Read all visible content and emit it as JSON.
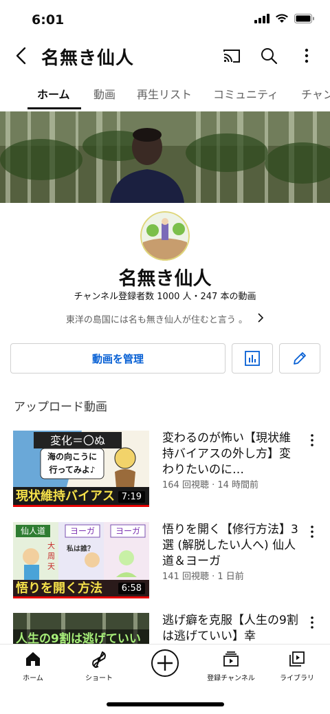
{
  "status_bar": {
    "time": "6:01"
  },
  "app_bar": {
    "title": "名無き仙人",
    "back_icon": "back-arrow-icon",
    "actions": [
      "cast-icon",
      "search-icon",
      "more-vert-icon"
    ]
  },
  "tabs": [
    {
      "label": "ホーム",
      "active": true
    },
    {
      "label": "動画"
    },
    {
      "label": "再生リスト"
    },
    {
      "label": "コミュニティ"
    },
    {
      "label": "チャン"
    }
  ],
  "channel": {
    "name": "名無き仙人",
    "meta": "チャンネル登録者数 1000 人・247 本の動画",
    "description": "東洋の島国には名も無き仙人が住むと言う 。",
    "manage_button": "動画を管理"
  },
  "section": {
    "title": "アップロード動画"
  },
  "videos": [
    {
      "title": "変わるのが怖い【現状維持バイアスの外し方】変わりたいのに…",
      "meta": "164 回視聴 · 14 時間前",
      "duration": "7:19",
      "thumb_texts": [
        "変化＝〇ぬ",
        "海の向こうに",
        "行ってみよ♪",
        "現状維持バイアス"
      ]
    },
    {
      "title": "悟りを開く【修行方法】3選 (解脱したい人へ) 仙人道＆ヨーガ",
      "meta": "141 回視聴 · 1 日前",
      "duration": "6:58",
      "thumb_texts": [
        "仙人道",
        "ヨーガ",
        "ヨーガ",
        "大",
        "周",
        "天",
        "私は誰？",
        "悟りを開く方法"
      ]
    },
    {
      "title": "逃げ癖を克服【人生の9割は逃げていい】幸",
      "meta": "",
      "duration": "",
      "thumb_texts": [
        "人生の9割は逃げていい"
      ]
    }
  ],
  "bottom_nav": [
    {
      "label": "ホーム",
      "icon": "home-icon"
    },
    {
      "label": "ショート",
      "icon": "shorts-icon"
    },
    {
      "label": "",
      "icon": "create-plus-icon"
    },
    {
      "label": "登録チャンネル",
      "icon": "subscriptions-icon"
    },
    {
      "label": "ライブラリ",
      "icon": "library-icon"
    }
  ],
  "colors": {
    "accent_blue": "#065fd4",
    "text_primary": "#0f0f0f",
    "text_secondary": "#606060"
  }
}
